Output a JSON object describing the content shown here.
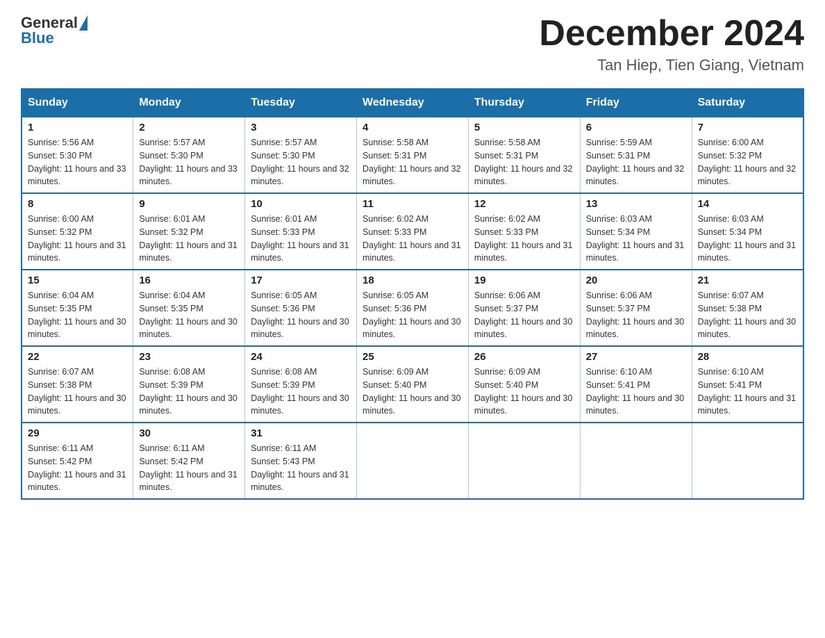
{
  "logo": {
    "general": "General",
    "blue": "Blue"
  },
  "title": {
    "month": "December 2024",
    "location": "Tan Hiep, Tien Giang, Vietnam"
  },
  "weekdays": [
    "Sunday",
    "Monday",
    "Tuesday",
    "Wednesday",
    "Thursday",
    "Friday",
    "Saturday"
  ],
  "weeks": [
    [
      {
        "day": "1",
        "sunrise": "5:56 AM",
        "sunset": "5:30 PM",
        "daylight": "11 hours and 33 minutes."
      },
      {
        "day": "2",
        "sunrise": "5:57 AM",
        "sunset": "5:30 PM",
        "daylight": "11 hours and 33 minutes."
      },
      {
        "day": "3",
        "sunrise": "5:57 AM",
        "sunset": "5:30 PM",
        "daylight": "11 hours and 32 minutes."
      },
      {
        "day": "4",
        "sunrise": "5:58 AM",
        "sunset": "5:31 PM",
        "daylight": "11 hours and 32 minutes."
      },
      {
        "day": "5",
        "sunrise": "5:58 AM",
        "sunset": "5:31 PM",
        "daylight": "11 hours and 32 minutes."
      },
      {
        "day": "6",
        "sunrise": "5:59 AM",
        "sunset": "5:31 PM",
        "daylight": "11 hours and 32 minutes."
      },
      {
        "day": "7",
        "sunrise": "6:00 AM",
        "sunset": "5:32 PM",
        "daylight": "11 hours and 32 minutes."
      }
    ],
    [
      {
        "day": "8",
        "sunrise": "6:00 AM",
        "sunset": "5:32 PM",
        "daylight": "11 hours and 31 minutes."
      },
      {
        "day": "9",
        "sunrise": "6:01 AM",
        "sunset": "5:32 PM",
        "daylight": "11 hours and 31 minutes."
      },
      {
        "day": "10",
        "sunrise": "6:01 AM",
        "sunset": "5:33 PM",
        "daylight": "11 hours and 31 minutes."
      },
      {
        "day": "11",
        "sunrise": "6:02 AM",
        "sunset": "5:33 PM",
        "daylight": "11 hours and 31 minutes."
      },
      {
        "day": "12",
        "sunrise": "6:02 AM",
        "sunset": "5:33 PM",
        "daylight": "11 hours and 31 minutes."
      },
      {
        "day": "13",
        "sunrise": "6:03 AM",
        "sunset": "5:34 PM",
        "daylight": "11 hours and 31 minutes."
      },
      {
        "day": "14",
        "sunrise": "6:03 AM",
        "sunset": "5:34 PM",
        "daylight": "11 hours and 31 minutes."
      }
    ],
    [
      {
        "day": "15",
        "sunrise": "6:04 AM",
        "sunset": "5:35 PM",
        "daylight": "11 hours and 30 minutes."
      },
      {
        "day": "16",
        "sunrise": "6:04 AM",
        "sunset": "5:35 PM",
        "daylight": "11 hours and 30 minutes."
      },
      {
        "day": "17",
        "sunrise": "6:05 AM",
        "sunset": "5:36 PM",
        "daylight": "11 hours and 30 minutes."
      },
      {
        "day": "18",
        "sunrise": "6:05 AM",
        "sunset": "5:36 PM",
        "daylight": "11 hours and 30 minutes."
      },
      {
        "day": "19",
        "sunrise": "6:06 AM",
        "sunset": "5:37 PM",
        "daylight": "11 hours and 30 minutes."
      },
      {
        "day": "20",
        "sunrise": "6:06 AM",
        "sunset": "5:37 PM",
        "daylight": "11 hours and 30 minutes."
      },
      {
        "day": "21",
        "sunrise": "6:07 AM",
        "sunset": "5:38 PM",
        "daylight": "11 hours and 30 minutes."
      }
    ],
    [
      {
        "day": "22",
        "sunrise": "6:07 AM",
        "sunset": "5:38 PM",
        "daylight": "11 hours and 30 minutes."
      },
      {
        "day": "23",
        "sunrise": "6:08 AM",
        "sunset": "5:39 PM",
        "daylight": "11 hours and 30 minutes."
      },
      {
        "day": "24",
        "sunrise": "6:08 AM",
        "sunset": "5:39 PM",
        "daylight": "11 hours and 30 minutes."
      },
      {
        "day": "25",
        "sunrise": "6:09 AM",
        "sunset": "5:40 PM",
        "daylight": "11 hours and 30 minutes."
      },
      {
        "day": "26",
        "sunrise": "6:09 AM",
        "sunset": "5:40 PM",
        "daylight": "11 hours and 30 minutes."
      },
      {
        "day": "27",
        "sunrise": "6:10 AM",
        "sunset": "5:41 PM",
        "daylight": "11 hours and 30 minutes."
      },
      {
        "day": "28",
        "sunrise": "6:10 AM",
        "sunset": "5:41 PM",
        "daylight": "11 hours and 31 minutes."
      }
    ],
    [
      {
        "day": "29",
        "sunrise": "6:11 AM",
        "sunset": "5:42 PM",
        "daylight": "11 hours and 31 minutes."
      },
      {
        "day": "30",
        "sunrise": "6:11 AM",
        "sunset": "5:42 PM",
        "daylight": "11 hours and 31 minutes."
      },
      {
        "day": "31",
        "sunrise": "6:11 AM",
        "sunset": "5:43 PM",
        "daylight": "11 hours and 31 minutes."
      },
      null,
      null,
      null,
      null
    ]
  ]
}
